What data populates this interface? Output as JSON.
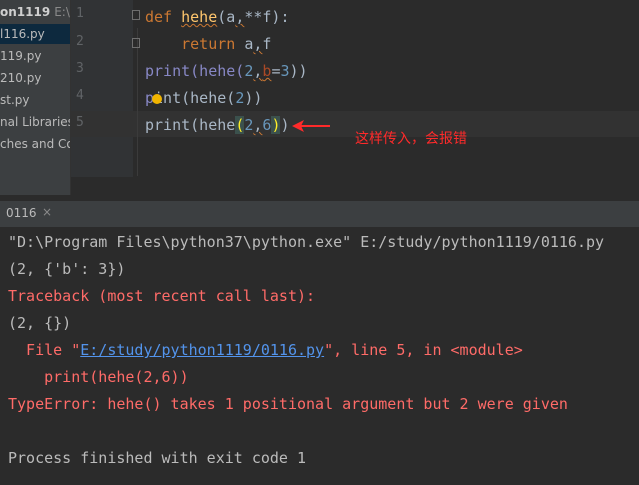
{
  "sidebar": {
    "items": [
      {
        "label": "on1119",
        "path": "E:\\stu"
      },
      {
        "label": "l116.py"
      },
      {
        "label": "119.py"
      },
      {
        "label": "210.py"
      },
      {
        "label": "st.py"
      },
      {
        "label": "nal Libraries"
      },
      {
        "label": "ches and Co"
      }
    ]
  },
  "editor": {
    "line_numbers": [
      "1",
      "2",
      "3",
      "4",
      "5"
    ],
    "lines": [
      {
        "def": "def",
        "name": "hehe",
        "open": "(",
        "a": "a",
        "comma": ",",
        "rest": "**f):"
      },
      {
        "ret": "return",
        "a": "a",
        "comma": ",",
        "f": "f"
      },
      {
        "call": "print(hehe(",
        "n": "2",
        "comma": ",",
        "b": "b",
        "eq": "=",
        "v": "3",
        "close": "))"
      },
      {
        "p": "p",
        "rest": "int(hehe(",
        "n": "2",
        "close": "))"
      },
      {
        "call": "print(hehe",
        "open": "(",
        "n1": "2",
        "comma": ",",
        "n2": "6",
        "close": ")",
        "close2": ")"
      }
    ],
    "annotation": "这样传入，会报错"
  },
  "run": {
    "tab_label": "0116",
    "close_label": "×",
    "output": {
      "cmd": "\"D:\\Program Files\\python37\\python.exe\" E:/study/python1119/0116.py",
      "out1": "(2, {'b': 3})",
      "traceback": "Traceback (most recent call last):",
      "out2": "(2, {})",
      "file_prefix": "  File \"",
      "file_link": "E:/study/python1119/0116.py",
      "file_suffix": "\", line 5, in <module>",
      "code": "    print(hehe(2,6))",
      "error": "TypeError: hehe() takes 1 positional argument but 2 were given",
      "finish": "Process finished with exit code 1"
    }
  },
  "colors": {
    "keyword": "#cc7832",
    "function": "#ffc66d",
    "builtin": "#8888c6",
    "number": "#6897bb",
    "error": "#ff6b68",
    "link": "#5394ec",
    "annotation": "#ff2a2a"
  }
}
